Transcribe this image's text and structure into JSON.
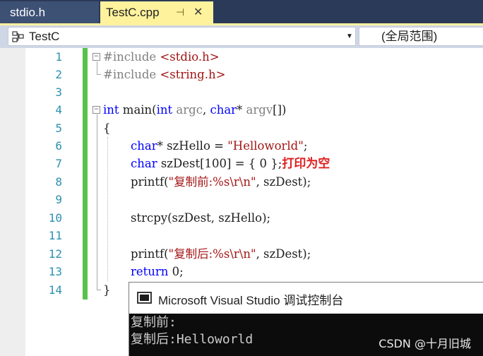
{
  "tabs": [
    {
      "label": "stdio.h",
      "active": false
    },
    {
      "label": "TestC.cpp",
      "active": true
    }
  ],
  "icons": {
    "pin": "pin-icon",
    "close": "close-icon",
    "class": "class-icon",
    "dropdown": "chevron-down-icon",
    "console": "console-app-icon"
  },
  "colors": {
    "keyword": "#0000ff",
    "preprocessor": "#808080",
    "string": "#a31515",
    "line_number": "#2b91af",
    "change_bar": "#57c24a",
    "active_tab": "#fff29d",
    "annotation": "#e02020"
  },
  "navbar": {
    "scope_left": "TestC",
    "scope_right": "(全局范围)"
  },
  "editor": {
    "line_numbers": [
      "1",
      "2",
      "3",
      "4",
      "5",
      "6",
      "7",
      "8",
      "9",
      "10",
      "11",
      "12",
      "13",
      "14"
    ],
    "code": {
      "l1": {
        "directive": "#include",
        "header": "<stdio.h>"
      },
      "l2": {
        "directive": "#include",
        "header": "<string.h>"
      },
      "l4": {
        "type": "int",
        "func": "main(",
        "type2": "int",
        "arg1": "argc",
        "sep": ",",
        "type3": "char",
        "star": "*",
        "arg2": "argv",
        "tail": "[])"
      },
      "l5": {
        "text": "{"
      },
      "l6": {
        "type": "char",
        "rest": "* szHello = ",
        "literal": "\"Helloworld\"",
        "end": ";"
      },
      "l7": {
        "type": "char",
        "rest": " szDest[100] = { 0 };",
        "annotation": "打印为空"
      },
      "l8": {
        "fn": "printf(",
        "literal": "\"复制前:%s\\r\\n\"",
        "rest": ", szDest);"
      },
      "l10": {
        "text": "strcpy(szDest, szHello);"
      },
      "l12": {
        "fn": "printf(",
        "literal": "\"复制后:%s\\r\\n\"",
        "rest": ", szDest);"
      },
      "l13": {
        "kw": "return",
        "rest": " 0;"
      },
      "l14": {
        "text": "}"
      }
    }
  },
  "console": {
    "title": "Microsoft Visual Studio 调试控制台",
    "lines": [
      "复制前:",
      "复制后:Helloworld"
    ],
    "watermark": "CSDN @十月旧城"
  }
}
